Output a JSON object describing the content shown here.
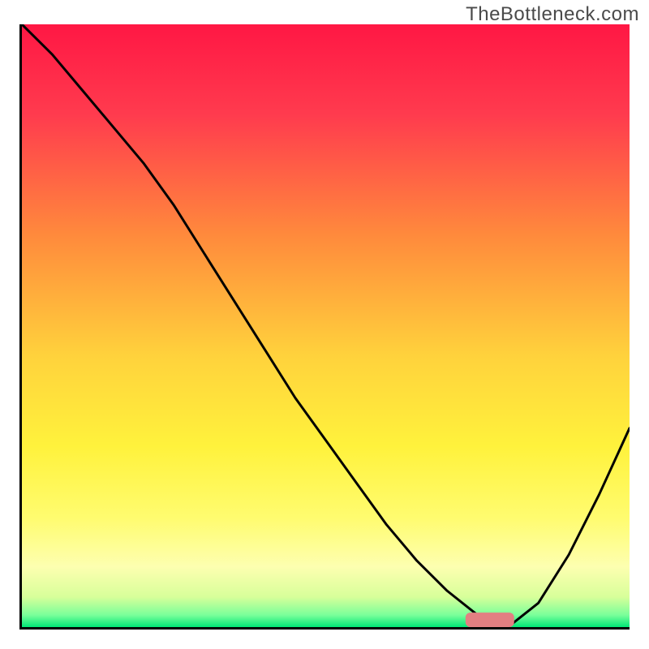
{
  "watermark": "TheBottleneck.com",
  "chart_data": {
    "type": "line",
    "title": "",
    "xlabel": "",
    "ylabel": "",
    "xlim": [
      0,
      100
    ],
    "ylim": [
      0,
      100
    ],
    "grid": false,
    "legend": false,
    "series": [
      {
        "name": "curve",
        "x": [
          0,
          5,
          10,
          15,
          20,
          25,
          30,
          35,
          40,
          45,
          50,
          55,
          60,
          65,
          70,
          75,
          78,
          80,
          85,
          90,
          95,
          100
        ],
        "y": [
          100,
          95,
          89,
          83,
          77,
          70,
          62,
          54,
          46,
          38,
          31,
          24,
          17,
          11,
          6,
          2,
          0,
          0,
          4,
          12,
          22,
          33
        ]
      }
    ],
    "marker": {
      "name": "highlight",
      "shape": "rounded-rect",
      "color": "#e37f82",
      "x_center": 77,
      "y_center": 1.2,
      "width": 8,
      "height": 2.4
    },
    "background_gradient": {
      "type": "vertical",
      "stops": [
        {
          "pos": 0.0,
          "color": "#ff1744"
        },
        {
          "pos": 0.15,
          "color": "#ff3b4e"
        },
        {
          "pos": 0.35,
          "color": "#ff8a3c"
        },
        {
          "pos": 0.55,
          "color": "#ffd23c"
        },
        {
          "pos": 0.7,
          "color": "#fff23c"
        },
        {
          "pos": 0.82,
          "color": "#fffc70"
        },
        {
          "pos": 0.9,
          "color": "#fdffb0"
        },
        {
          "pos": 0.95,
          "color": "#d8ff9a"
        },
        {
          "pos": 0.98,
          "color": "#7aff9a"
        },
        {
          "pos": 1.0,
          "color": "#00e676"
        }
      ]
    }
  }
}
